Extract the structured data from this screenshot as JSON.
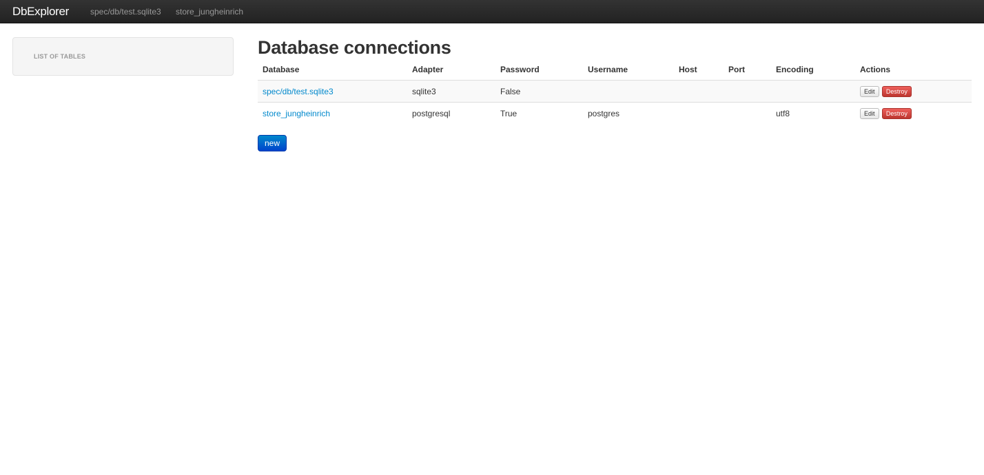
{
  "navbar": {
    "brand": "DbExplorer",
    "links": [
      "spec/db/test.sqlite3",
      "store_jungheinrich"
    ]
  },
  "sidebar": {
    "header": "LIST OF TABLES"
  },
  "main": {
    "title": "Database connections",
    "table": {
      "columns": [
        "Database",
        "Adapter",
        "Password",
        "Username",
        "Host",
        "Port",
        "Encoding",
        "Actions"
      ],
      "rows": [
        {
          "database": "spec/db/test.sqlite3",
          "adapter": "sqlite3",
          "password": "False",
          "username": "",
          "host": "",
          "port": "",
          "encoding": "",
          "edit_label": "Edit",
          "destroy_label": "Destroy"
        },
        {
          "database": "store_jungheinrich",
          "adapter": "postgresql",
          "password": "True",
          "username": "postgres",
          "host": "",
          "port": "",
          "encoding": "utf8",
          "edit_label": "Edit",
          "destroy_label": "Destroy"
        }
      ]
    },
    "new_button": "new"
  },
  "colors": {
    "navbar_bg": "#222222",
    "link": "#0088cc",
    "danger": "#da4f49",
    "primary": "#0074cc"
  }
}
